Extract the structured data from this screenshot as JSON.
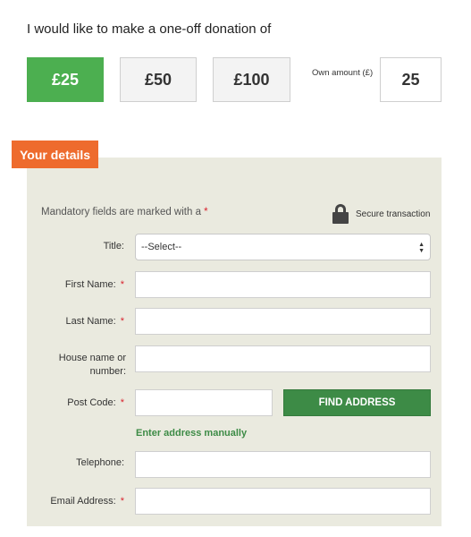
{
  "donation": {
    "intro": "I would like to make a one-off donation of",
    "amounts": [
      "£25",
      "£50",
      "£100"
    ],
    "selected": "£25",
    "own_amount_label": "Own amount (£)",
    "own_amount_value": "25"
  },
  "details": {
    "tab_label": "Your details",
    "mandatory_text": "Mandatory fields are marked with a",
    "required_marker": "*",
    "secure_text": "Secure transaction",
    "title_label": "Title:",
    "title_selected": "--Select--",
    "first_name_label": "First Name:",
    "last_name_label": "Last Name:",
    "house_label": "House name or number:",
    "postcode_label": "Post Code:",
    "find_address_label": "FIND ADDRESS",
    "manual_address_link": "Enter address manually",
    "telephone_label": "Telephone:",
    "email_label": "Email Address:"
  },
  "colors": {
    "selected_amount": "#4caf50",
    "tab": "#ee6b2d",
    "panel": "#eaeadf",
    "find_button": "#3d8b46",
    "required": "#d9232e"
  }
}
